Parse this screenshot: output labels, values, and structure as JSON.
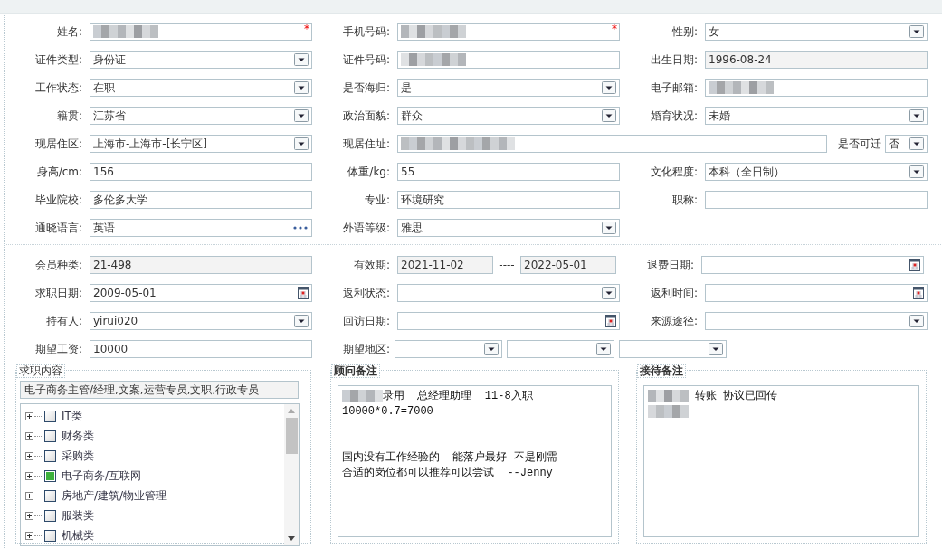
{
  "personal": {
    "rows": [
      [
        {
          "label": "姓名:",
          "kind": "text",
          "redacted": true,
          "required_mark": "*"
        },
        {
          "label": "手机号码:",
          "kind": "text",
          "redacted": true,
          "required_mark": "*"
        },
        {
          "label": "性别:",
          "kind": "select",
          "value": "女"
        }
      ],
      [
        {
          "label": "证件类型:",
          "kind": "select",
          "value": "身份证"
        },
        {
          "label": "证件号码:",
          "kind": "text",
          "redacted": true
        },
        {
          "label": "出生日期:",
          "kind": "readonly",
          "value": "1996-08-24"
        }
      ],
      [
        {
          "label": "工作状态:",
          "kind": "select",
          "value": "在职"
        },
        {
          "label": "是否海归:",
          "kind": "select",
          "value": "是"
        },
        {
          "label": "电子邮箱:",
          "kind": "text",
          "redacted": true
        }
      ],
      [
        {
          "label": "籍贯:",
          "kind": "select",
          "value": "江苏省"
        },
        {
          "label": "政治面貌:",
          "kind": "select",
          "value": "群众"
        },
        {
          "label": "婚育状况:",
          "kind": "select",
          "value": "未婚"
        }
      ],
      [
        {
          "label": "现居住区:",
          "kind": "select",
          "value": " 上海市-上海市-[长宁区]"
        },
        {
          "label": "现居住址:",
          "kind": "wide_text",
          "redacted": true
        },
        {
          "label": "是否可迁",
          "kind": "inline_select",
          "value": "否"
        }
      ],
      [
        {
          "label": "身高/cm:",
          "kind": "text",
          "value": "156"
        },
        {
          "label": "体重/kg:",
          "kind": "text",
          "value": "55"
        },
        {
          "label": "文化程度:",
          "kind": "select",
          "value": "本科（全日制）"
        }
      ],
      [
        {
          "label": "毕业院校:",
          "kind": "text",
          "value": "多伦多大学"
        },
        {
          "label": "专业:",
          "kind": "text",
          "value": "环境研究"
        },
        {
          "label": "职称:",
          "kind": "text"
        }
      ],
      [
        {
          "label": "通晓语言:",
          "kind": "lookup",
          "value": "英语"
        },
        {
          "label": "外语等级:",
          "kind": "select",
          "value": "雅思"
        }
      ]
    ]
  },
  "membership": {
    "rows": [
      [
        {
          "label": "会员种类:",
          "kind": "readonly",
          "value": "21-498"
        },
        {
          "label": "有效期:",
          "kind": "range",
          "value": "2021-11-02",
          "separator": "----",
          "value_end": "2022-05-01"
        },
        {
          "label": "退费日期:",
          "kind": "date"
        }
      ],
      [
        {
          "label": "求职日期:",
          "kind": "date",
          "value": "2009-05-01"
        },
        {
          "label": "返利状态:",
          "kind": "select"
        },
        {
          "label": "返利时间:",
          "kind": "date"
        }
      ],
      [
        {
          "label": "持有人:",
          "kind": "select",
          "value": "yirui020"
        },
        {
          "label": "回访日期:",
          "kind": "date"
        },
        {
          "label": "来源途径:",
          "kind": "select"
        }
      ],
      [
        {
          "label": "期望工资:",
          "kind": "text",
          "value": "10000"
        },
        {
          "label": "期望地区:",
          "kind": "multi_select",
          "parts": [
            {
              "kind": "select"
            },
            {
              "kind": "select"
            },
            {
              "kind": "select"
            }
          ]
        }
      ]
    ]
  },
  "job_intent": {
    "legend": "求职内容",
    "summary": "电子商务主管/经理,文案,运营专员,文职,行政专员",
    "categories": [
      {
        "label": "IT类",
        "checked": false
      },
      {
        "label": "财务类",
        "checked": false
      },
      {
        "label": "采购类",
        "checked": false
      },
      {
        "label": "电子商务/互联网",
        "checked": true
      },
      {
        "label": "房地产/建筑/物业管理",
        "checked": false
      },
      {
        "label": "服装类",
        "checked": false
      },
      {
        "label": "机械类",
        "checked": false
      }
    ]
  },
  "notes": [
    {
      "legend": "顾问备注",
      "paragraphs": [
        [
          {
            "redacted": true,
            "text": "录用  总经理助理  11-8入职"
          },
          {
            "text": "10000*0.7=7000"
          }
        ],
        [
          {
            "text": "国内没有工作经验的  能落户最好 不是刚需"
          },
          {
            "text": "合适的岗位都可以推荐可以尝试  --Jenny"
          }
        ]
      ]
    },
    {
      "legend": "接待备注",
      "paragraphs": [
        [
          {
            "redacted": true,
            "text": " 转账 协议已回传"
          },
          {
            "redacted": true
          }
        ]
      ]
    }
  ]
}
